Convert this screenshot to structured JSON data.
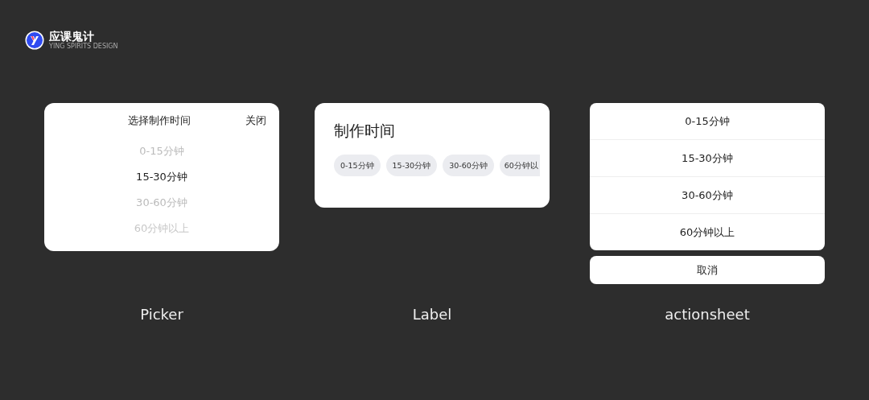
{
  "logo": {
    "name": "应课鬼计",
    "tagline": "YING SPIRITS DESIGN"
  },
  "picker": {
    "title": "选择制作时间",
    "close": "关闭",
    "options": [
      {
        "label": "0-15分钟",
        "selected": false
      },
      {
        "label": "15-30分钟",
        "selected": true
      },
      {
        "label": "30-60分钟",
        "selected": false
      },
      {
        "label": "60分钟以上",
        "selected": false
      }
    ],
    "caption": "Picker"
  },
  "label": {
    "title": "制作时间",
    "chips": [
      "0-15分钟",
      "15-30分钟",
      "30-60分钟",
      "60分钟以"
    ],
    "caption": "Label"
  },
  "actionsheet": {
    "options": [
      "0-15分钟",
      "15-30分钟",
      "30-60分钟",
      "60分钟以上"
    ],
    "cancel": "取消",
    "caption": "actionsheet"
  }
}
